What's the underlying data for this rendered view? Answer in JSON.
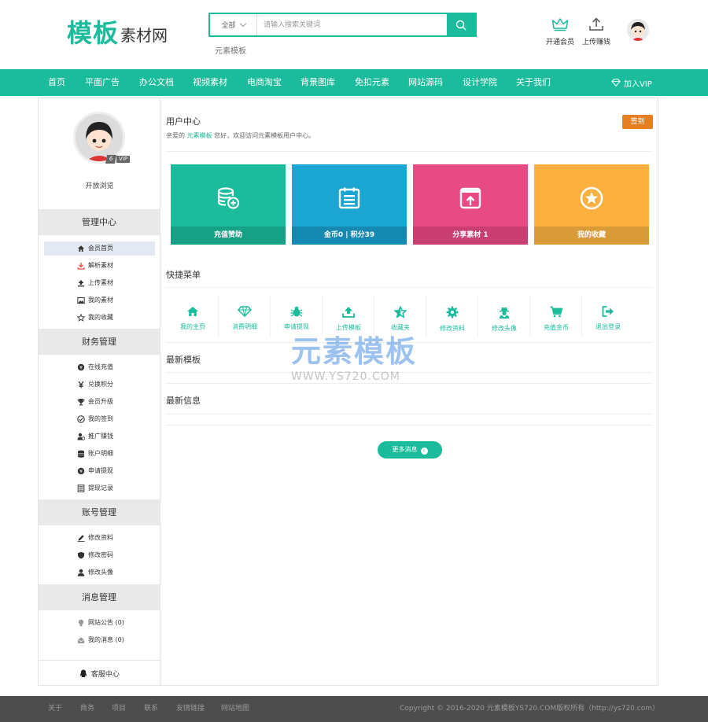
{
  "header": {
    "logo_main": "模板",
    "logo_sub": "素材网",
    "search": {
      "category": "全部",
      "placeholder": "请输入搜索关键词"
    },
    "hot_word": "元素模板",
    "actions": [
      {
        "label": "开通会员",
        "icon": "crown-icon"
      },
      {
        "label": "上传赚钱",
        "icon": "upload-icon"
      }
    ]
  },
  "nav": {
    "items": [
      "首页",
      "平面广告",
      "办公文档",
      "视频素材",
      "电商淘宝",
      "背景图库",
      "免扣元素",
      "网站源码",
      "设计学院",
      "关于我们"
    ],
    "vip": "加入VIP"
  },
  "sidebar": {
    "vip_badge": "VIP",
    "vip_level": "6",
    "browse": "开放浏览",
    "groups": [
      {
        "title": "管理中心",
        "items": [
          "会员首页",
          "解析素材",
          "上传素材",
          "我的素材",
          "我的收藏"
        ]
      },
      {
        "title": "财务管理",
        "items": [
          "在线充值",
          "兑换积分",
          "会员升级",
          "我的签到",
          "推广赚钱",
          "账户明细",
          "申请提现",
          "提现记录"
        ]
      },
      {
        "title": "账号管理",
        "items": [
          "修改资料",
          "修改密码",
          "修改头像"
        ]
      },
      {
        "title": "消息管理",
        "items": [
          "网站公告 (0)",
          "我的消息 (0)"
        ]
      }
    ],
    "service": "客服中心"
  },
  "content": {
    "title": "用户中心",
    "greet_prefix": "亲爱的",
    "username": "元素模板",
    "greet_suffix": "您好，欢迎访问元素模板用户中心。",
    "checkin": "签到",
    "cards": [
      {
        "label": "充值赞助",
        "color": "#1abc9c",
        "foot": "#16a085"
      },
      {
        "label": "金币0 | 积分39",
        "color": "#1aa5d3",
        "foot": "#1589b2"
      },
      {
        "label": "分享素材 1",
        "color": "#e84b84",
        "foot": "#c93f71"
      },
      {
        "label": "我的收藏",
        "color": "#fbb040",
        "foot": "#d99a38"
      }
    ],
    "quick_title": "快捷菜单",
    "quick": [
      "我的主页",
      "消费明细",
      "申请提现",
      "上传模板",
      "收藏夹",
      "修改资料",
      "修改头像",
      "充值金币",
      "退出登录"
    ],
    "latest_templates": "最新模板",
    "latest_info": "最新信息",
    "more": "更多消息"
  },
  "watermark": {
    "main": "元素模板",
    "sub": "WWW.YS720.COM"
  },
  "footer": {
    "links": [
      "关于",
      "商务",
      "项目",
      "联系",
      "友情链接",
      "网站地图"
    ],
    "copyright": "Copyright © 2016-2020 元素模板YS720.COM版权所有（http://ys720.com）"
  },
  "colors": {
    "accent": "#1bbc9b",
    "checkin": "#e67e22",
    "footer": "#4d4d4d"
  }
}
